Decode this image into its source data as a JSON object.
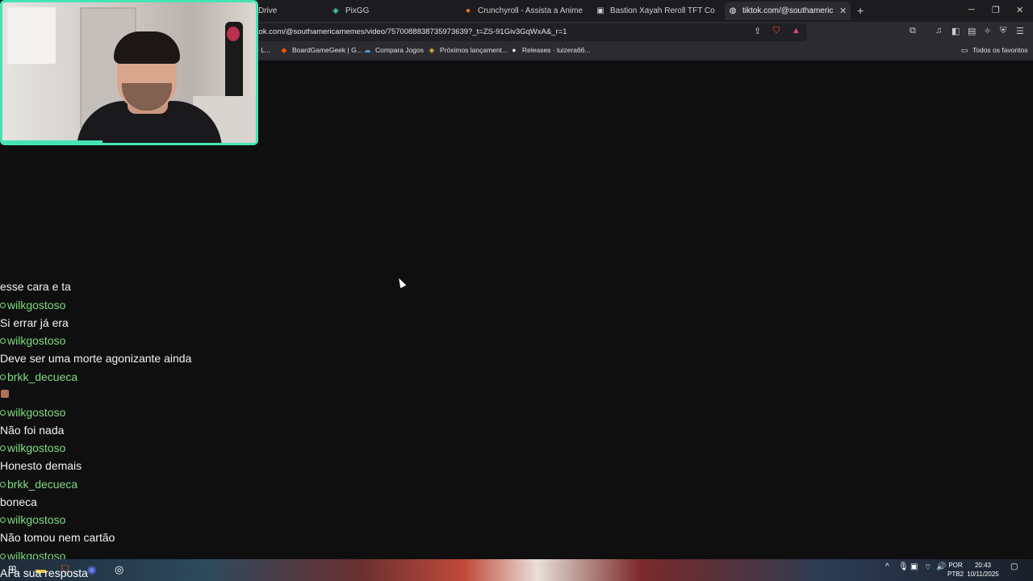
{
  "browser": {
    "tabs": [
      {
        "label": "Drive",
        "icon": "drive-icon"
      },
      {
        "label": "PixGG",
        "icon": "pixgg-icon"
      },
      {
        "label": "Crunchyroll - Assista a Animes, Jogue",
        "icon": "crunchyroll-icon"
      },
      {
        "label": "Bastion Xayah Reroll TFT Comp Guide",
        "icon": "bastion-icon"
      },
      {
        "label": "tiktok.com/@southamericamemes",
        "icon": "globe-icon"
      }
    ],
    "url": "tok.com/@southamericamemes/video/7570088838735973639?_t=ZS-91Giv3GqWxA&_r=1",
    "bookmarks": [
      {
        "label": "- L...",
        "icon": "folder-icon"
      },
      {
        "label": "BoardGameGeek | G...",
        "icon": "boardgamegeek-icon"
      },
      {
        "label": "Compara Jogos",
        "icon": "compara-icon"
      },
      {
        "label": "Próximos lançament...",
        "icon": "diamond-icon"
      },
      {
        "label": "Releases · luizera66...",
        "icon": "github-icon"
      }
    ],
    "favorites_label": "Todos os favoritos",
    "colors": {
      "accent": "#45e4b4",
      "username": "#7fdc7f"
    }
  },
  "chat": {
    "lines": [
      {
        "type": "msg",
        "text": "esse cara e ta"
      },
      {
        "type": "user",
        "text": "wilkgostoso"
      },
      {
        "type": "msg",
        "text": "Si errar já era"
      },
      {
        "type": "user",
        "text": "wilkgostoso"
      },
      {
        "type": "msg",
        "text": "Deve ser uma morte agonizante ainda"
      },
      {
        "type": "user",
        "text": "brkk_decueca"
      },
      {
        "type": "emote",
        "text": ""
      },
      {
        "type": "user",
        "text": "wilkgostoso"
      },
      {
        "type": "msg",
        "text": "Não foi nada"
      },
      {
        "type": "user",
        "text": "wilkgostoso"
      },
      {
        "type": "msg",
        "text": "Honesto demais"
      },
      {
        "type": "user",
        "text": "brkk_decueca"
      },
      {
        "type": "msg",
        "text": "boneca"
      },
      {
        "type": "user",
        "text": "wilkgostoso"
      },
      {
        "type": "msg",
        "text": "Não tomou nem cartão"
      },
      {
        "type": "user",
        "text": "wilkgostoso"
      }
    ],
    "reply": "Aí a sua resposta"
  },
  "taskbar": {
    "language": [
      "POR",
      "PTB2"
    ],
    "time": "20:43",
    "date": "10/11/2025"
  }
}
